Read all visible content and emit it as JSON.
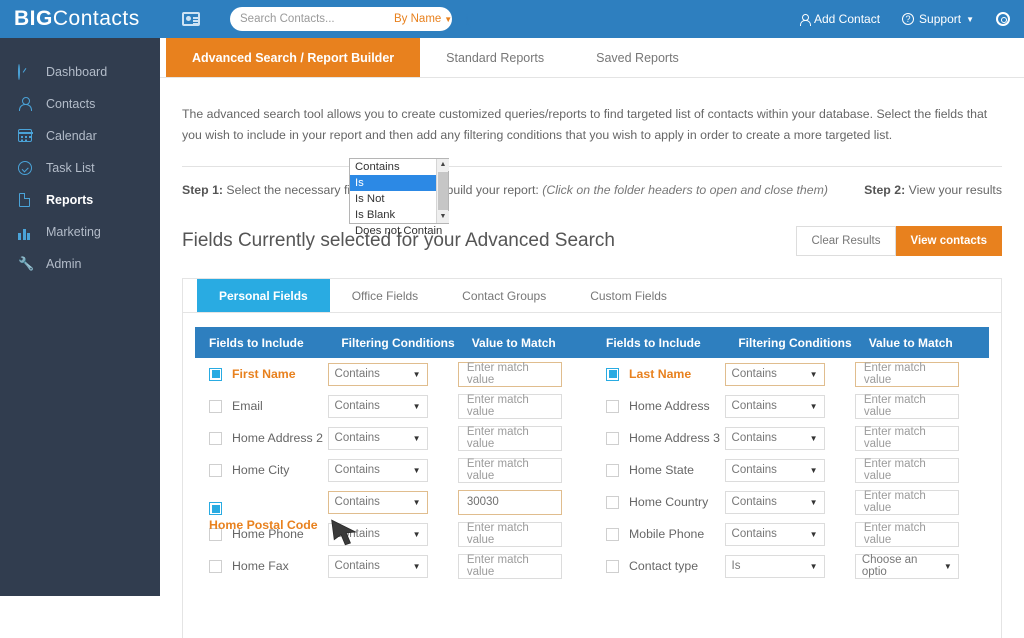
{
  "brand": {
    "big": "BIG",
    "rest": "Contacts"
  },
  "topbar": {
    "search_placeholder": "Search Contacts...",
    "search_value": "",
    "search_scope": "By Name",
    "add_contact": "Add Contact",
    "support": "Support",
    "colors": {
      "bar": "#2E7FBF",
      "accent_orange": "#E8811E",
      "sidebar": "#313d4f",
      "light_blue": "#29ABE2"
    }
  },
  "sidebar": {
    "items": [
      {
        "label": "Dashboard",
        "icon": "gauge-icon",
        "active": false
      },
      {
        "label": "Contacts",
        "icon": "person-icon",
        "active": false
      },
      {
        "label": "Calendar",
        "icon": "calendar-icon",
        "active": false
      },
      {
        "label": "Task List",
        "icon": "check-circle-icon",
        "active": false
      },
      {
        "label": "Reports",
        "icon": "document-icon",
        "active": true
      },
      {
        "label": "Marketing",
        "icon": "bar-chart-icon",
        "active": false
      },
      {
        "label": "Admin",
        "icon": "wrench-icon",
        "active": false
      }
    ]
  },
  "tabs": [
    {
      "label": "Advanced Search / Report Builder",
      "active": true
    },
    {
      "label": "Standard Reports",
      "active": false
    },
    {
      "label": "Saved Reports",
      "active": false
    }
  ],
  "intro": "The advanced search tool allows you to create customized queries/reports to find targeted list of contacts within your database. Select the fields that you wish to include in your report and then add any filtering conditions that you wish to apply in order to create a more targeted list.",
  "steps": {
    "step1_label": "Step 1:",
    "step1_text": "Select the necessary fields and filters to build your report:",
    "step1_hint": "(Click on the folder headers to open and close them)",
    "step2_label": "Step 2:",
    "step2_text": "View your results"
  },
  "section": {
    "title": "Fields Currently selected for your Advanced Search",
    "clear_button": "Clear Results",
    "view_button": "View contacts"
  },
  "subtabs": [
    {
      "label": "Personal Fields",
      "active": true
    },
    {
      "label": "Office Fields",
      "active": false
    },
    {
      "label": "Contact Groups",
      "active": false
    },
    {
      "label": "Custom Fields",
      "active": false
    }
  ],
  "table": {
    "headers": [
      "Fields to Include",
      "Filtering Conditions",
      "Value to Match",
      "Fields to Include",
      "Filtering Conditions",
      "Value to Match"
    ],
    "match_placeholder": "Enter match value",
    "left_rows": [
      {
        "field": "First Name",
        "checked": true,
        "condition": "Contains",
        "value": "",
        "highlight": true
      },
      {
        "field": "Email",
        "checked": false,
        "condition": "Contains",
        "value": "",
        "highlight": false
      },
      {
        "field": "Home Address 2",
        "checked": false,
        "condition": "Contains",
        "value": "",
        "highlight": false
      },
      {
        "field": "Home City",
        "checked": false,
        "condition": "Contains",
        "value": "",
        "highlight": false
      },
      {
        "field": "Home Postal Code",
        "checked": true,
        "condition": "Contains",
        "value": "30030",
        "highlight": true
      },
      {
        "field": "Home Phone",
        "checked": false,
        "condition": "Contains",
        "value": "",
        "highlight": false
      },
      {
        "field": "Home Fax",
        "checked": false,
        "condition": "Contains",
        "value": "",
        "highlight": false
      }
    ],
    "right_rows": [
      {
        "field": "Last Name",
        "checked": true,
        "condition": "Contains",
        "value": "",
        "highlight": true
      },
      {
        "field": "Home Address",
        "checked": false,
        "condition": "Contains",
        "value": "",
        "highlight": false
      },
      {
        "field": "Home Address 3",
        "checked": false,
        "condition": "Contains",
        "value": "",
        "highlight": false
      },
      {
        "field": "Home State",
        "checked": false,
        "condition": "Contains",
        "value": "",
        "highlight": false
      },
      {
        "field": "Home Country",
        "checked": false,
        "condition": "Contains",
        "value": "",
        "highlight": false
      },
      {
        "field": "Mobile Phone",
        "checked": false,
        "condition": "Contains",
        "value": "",
        "highlight": false
      },
      {
        "field": "Contact type",
        "checked": false,
        "condition": "Is",
        "value": "Choose an optio",
        "highlight": false,
        "value_is_select": true
      }
    ]
  },
  "dropdown": {
    "open": true,
    "selected": "Is",
    "options": [
      "Contains",
      "Is",
      "Is Not",
      "Is Blank",
      "Does not Contain"
    ]
  }
}
